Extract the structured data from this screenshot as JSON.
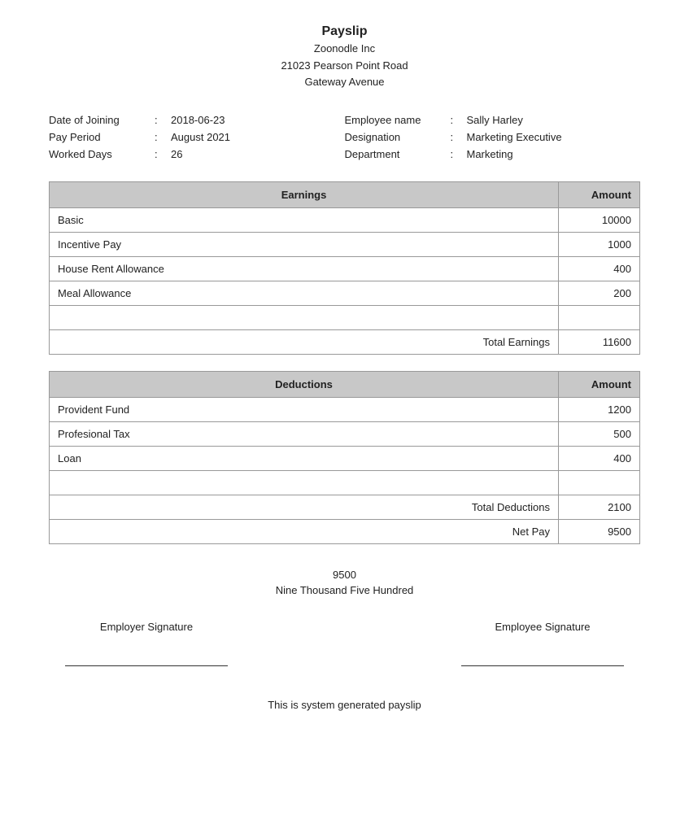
{
  "header": {
    "title": "Payslip",
    "company": "Zoonodle Inc",
    "address_line1": "21023 Pearson Point Road",
    "address_line2": "Gateway Avenue"
  },
  "employee_info": {
    "left": {
      "date_of_joining_label": "Date of Joining",
      "date_of_joining_value": "2018-06-23",
      "pay_period_label": "Pay Period",
      "pay_period_value": "August 2021",
      "worked_days_label": "Worked Days",
      "worked_days_value": "26"
    },
    "right": {
      "employee_name_label": "Employee name",
      "employee_name_value": "Sally Harley",
      "designation_label": "Designation",
      "designation_value": "Marketing Executive",
      "department_label": "Department",
      "department_value": "Marketing"
    }
  },
  "earnings_table": {
    "header_desc": "Earnings",
    "header_amount": "Amount",
    "rows": [
      {
        "desc": "Basic",
        "amount": "10000"
      },
      {
        "desc": "Incentive Pay",
        "amount": "1000"
      },
      {
        "desc": "House Rent Allowance",
        "amount": "400"
      },
      {
        "desc": "Meal Allowance",
        "amount": "200"
      }
    ],
    "total_label": "Total Earnings",
    "total_value": "11600"
  },
  "deductions_table": {
    "header_desc": "Deductions",
    "header_amount": "Amount",
    "rows": [
      {
        "desc": "Provident Fund",
        "amount": "1200"
      },
      {
        "desc": "Profesional Tax",
        "amount": "500"
      },
      {
        "desc": "Loan",
        "amount": "400"
      }
    ],
    "total_deductions_label": "Total Deductions",
    "total_deductions_value": "2100",
    "net_pay_label": "Net Pay",
    "net_pay_value": "9500"
  },
  "net_amount": {
    "number": "9500",
    "words": "Nine Thousand Five Hundred"
  },
  "signatures": {
    "employer_label": "Employer Signature",
    "employee_label": "Employee Signature"
  },
  "footer": {
    "text": "This is system generated payslip"
  },
  "colon": ":"
}
